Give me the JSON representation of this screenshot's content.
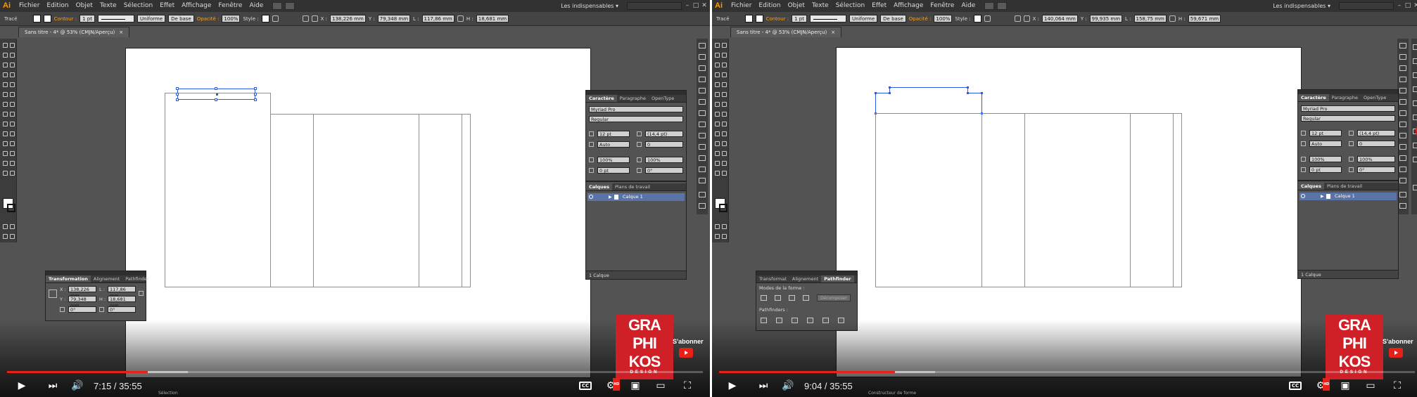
{
  "colors": {
    "accent_orange": "#f3a02b",
    "selection_blue": "#2d5be3",
    "progress_red": "#e62117",
    "logo_red": "#d02027",
    "layer_row_blue": "#5a74a8"
  },
  "app": {
    "logo": "Ai",
    "menu": [
      "Fichier",
      "Edition",
      "Objet",
      "Texte",
      "Sélection",
      "Effet",
      "Affichage",
      "Fenêtre",
      "Aide"
    ],
    "workspace": "Les indispensables",
    "window_buttons": [
      "–",
      "□",
      "✕"
    ]
  },
  "left": {
    "control_bar": {
      "mode": "Tracé",
      "stroke_label": "Contour :",
      "stroke_weight": "1 pt",
      "profile": "Uniforme",
      "brush": "De base",
      "opacity_label": "Opacité :",
      "opacity": "100%",
      "style_label": "Style :",
      "x_label": "X :",
      "x": "138,226 mm",
      "y_label": "Y :",
      "y": "79,348 mm",
      "w_label": "L :",
      "w": "117,86 mm",
      "h_label": "H :",
      "h": "18,681 mm"
    },
    "document_tab": "Sans titre - 4* @ 53% (CMJN/Aperçu)",
    "tab_close": "×",
    "character_panel": {
      "tabs": [
        "Caractère",
        "Paragraphe",
        "OpenType"
      ],
      "font": "Myriad Pro",
      "style": "Regular",
      "size": "12 pt",
      "leading": "(14,4 pt)",
      "kerning": "Auto",
      "tracking": "0",
      "vscale": "100%",
      "hscale": "100%",
      "baseline": "0 pt",
      "rotation": "0°"
    },
    "layers_panel": {
      "tabs": [
        "Calques",
        "Plans de travail"
      ],
      "layer_name": "Calque 1",
      "footer": "1 Calque"
    },
    "transform_panel": {
      "tabs": [
        "Transformation",
        "Alignement",
        "Pathfinder"
      ],
      "x_label": "X :",
      "x": "138,226 mm",
      "y_label": "Y :",
      "y": "79,348 mm",
      "w_label": "L :",
      "w": "117,86 mm",
      "h_label": "H :",
      "h": "18,681 mm",
      "angle": "0°",
      "shear": "0°"
    },
    "player": {
      "time": "7:15 / 35:55",
      "progress": 0.2025,
      "buffered": 0.26,
      "cc": "CC",
      "hd": "HD"
    },
    "status_text": "Sélection"
  },
  "right": {
    "control_bar": {
      "mode": "Tracé",
      "stroke_label": "Contour :",
      "stroke_weight": "1 pt",
      "profile": "Uniforme",
      "brush": "De base",
      "opacity_label": "Opacité :",
      "opacity": "100%",
      "style_label": "Style :",
      "x_label": "X :",
      "x": "140,064 mm",
      "y_label": "Y :",
      "y": "99,935 mm",
      "w_label": "L :",
      "w": "158,75 mm",
      "h_label": "H :",
      "h": "59,671 mm"
    },
    "document_tab": "Sans titre - 4* @ 53% (CMJN/Aperçu)",
    "tab_close": "×",
    "character_panel": {
      "tabs": [
        "Caractère",
        "Paragraphe",
        "OpenType"
      ],
      "font": "Myriad Pro",
      "style": "Regular",
      "size": "12 pt",
      "leading": "(14,4 pt)",
      "kerning": "Auto",
      "tracking": "0",
      "vscale": "100%",
      "hscale": "100%",
      "baseline": "0 pt",
      "rotation": "0°"
    },
    "layers_panel": {
      "tabs": [
        "Calques",
        "Plans de travail"
      ],
      "layer_name": "Calque 1",
      "footer": "1 Calque"
    },
    "pathfinder_panel": {
      "tabs": [
        "Transformat",
        "Alignement",
        "Pathfinder"
      ],
      "shape_modes_label": "Modes de la forme :",
      "expand_button": "Décomposer",
      "pathfinders_label": "Pathfinders :"
    },
    "player": {
      "time": "9:04 / 35:55",
      "progress": 0.2525,
      "buffered": 0.31,
      "cc": "CC",
      "hd": "HD"
    },
    "status_text": "Constructeur de forme"
  },
  "branding": {
    "logo_lines": [
      "GRA",
      "PHI",
      "KOS"
    ],
    "logo_sub": "DESIGN",
    "subscribe": "S'abonner"
  }
}
